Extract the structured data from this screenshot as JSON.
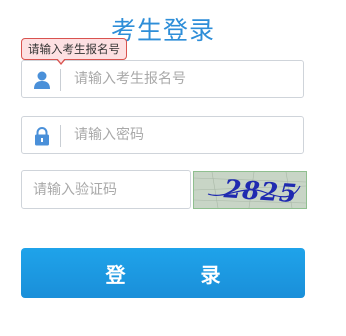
{
  "page": {
    "title": "考生登录"
  },
  "tooltip": {
    "text": "请输入考生报名号"
  },
  "form": {
    "username": {
      "value": "",
      "placeholder": "请输入考生报名号",
      "icon": "user-icon"
    },
    "password": {
      "value": "",
      "placeholder": "请输入密码",
      "icon": "lock-icon"
    },
    "captcha": {
      "value": "",
      "placeholder": "请输入验证码",
      "image_text": "2825"
    },
    "login_label": "登 录"
  },
  "colors": {
    "title": "#2e8ed8",
    "icon": "#4a90d9",
    "button": "#1a8fd9",
    "tooltip_border": "#d9534f",
    "tooltip_bg": "#fde0e2"
  }
}
